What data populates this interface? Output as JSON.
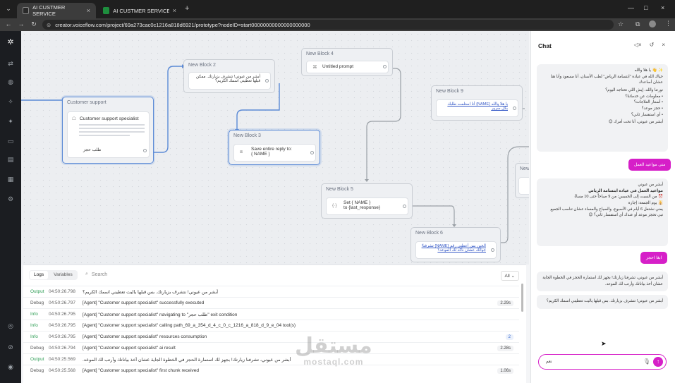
{
  "browser": {
    "tabs": [
      {
        "title": "AI CUSTMER SERVICE",
        "active": true
      },
      {
        "title": "AI CUSTMER SERVICE - Google",
        "active": false
      }
    ],
    "url": "creator.voiceflow.com/project/69a273cac0c1216a818d6921/prototype?nodeID=start00000000000000000000"
  },
  "canvas": {
    "customer_support": {
      "header": "Customer support",
      "title": "Customer support specialist",
      "exit_label": "طلب حجز"
    },
    "block2": {
      "header": "New Block 2",
      "text": "أبشر من عيوني! نتشرف بزيارتك. ممكن قبلها تعطيني اسمك الكريم؟"
    },
    "block3": {
      "header": "New Block 3",
      "text": "Save entire reply to:",
      "var": "{ NAME }"
    },
    "block4": {
      "header": "New Block 4",
      "text": "Untitled prompt"
    },
    "block5": {
      "header": "New Block 5",
      "line1": "Set { NAME }",
      "line2": "to {last_response}"
    },
    "block6": {
      "header": "New Block 6",
      "text": "الحين بس أعطني رقم {NAME} تشرفنا! جوالك عشان نأكد لك الموعد؟"
    },
    "block9": {
      "header": "New Block 9",
      "text": "يا هلا والله {NAME} أنا استلمت طلبك بكل سرور"
    },
    "block_partial": {
      "header": "New"
    }
  },
  "logs": {
    "tabs": [
      "Logs",
      "Variables"
    ],
    "search_placeholder": "Search",
    "filter": "All",
    "rows": [
      {
        "level": "Output",
        "time": "04:50:26.798",
        "message": "أبشر من عيوني! نتشرف بزيارتك. بس قبلها ياليت تعطيني اسمك الكريم؟",
        "badge": ""
      },
      {
        "level": "Debug",
        "time": "04:50:26.797",
        "message": "[Agent] \"Customer support specialist\" successfully executed",
        "badge": "2.29s"
      },
      {
        "level": "Info",
        "time": "04:50:26.795",
        "message": "[Agent] \"Customer support specialist\" navigating to \"طلب حجز\" exit condition",
        "badge": ""
      },
      {
        "level": "Info",
        "time": "04:50:26.795",
        "message": "[Agent] \"Customer support specialist\" calling path_69_a_354_d_4_c_0_c_1216_a_818_d_9_e_04 tool(s)",
        "badge": ""
      },
      {
        "level": "Info",
        "time": "04:50:26.795",
        "message": "[Agent] \"Customer support specialist\" resources consumption",
        "badge": "2"
      },
      {
        "level": "Debug",
        "time": "04:50:26.794",
        "message": "[Agent] \"Customer support specialist\" ai result",
        "badge": "2.28s"
      },
      {
        "level": "Output",
        "time": "04:50:25.569",
        "message": "أبشر من عيوني، تشرفنا زيارتك! بجهز لك استمارة الحجز في الخطوة الجاية عشان أخذ بياناتك وأرتب لك الموعد.",
        "badge": ""
      },
      {
        "level": "Debug",
        "time": "04:50:25.568",
        "message": "[Agent] \"Customer support specialist\" first chunk received",
        "badge": "1.06s"
      }
    ]
  },
  "chat": {
    "title": "Chat",
    "messages": [
      {
        "role": "bot",
        "lines": [
          "✨ 👋 يا هلا والله",
          "حياك الله في عيادة \"ابتسامة الرياض\" لطب الأسنان، أنا مسعود وأنا هنا عشان أساعدك",
          "نورتنا والله، إيش اللي تحتاجه اليوم؟",
          "• معلومات عن خدماتنا؟",
          "• أسعار العلاجات؟",
          "• حجز موعد؟",
          "• أي استفسار ثاني؟",
          "أبشر من عيوني، أنا تحت أمرك 😊"
        ]
      },
      {
        "role": "user",
        "text": "متى مواعيد العمل"
      },
      {
        "role": "bot",
        "lines": [
          "أبشر من عيوني",
          "مواعيد العمل في عيادة ابتسامة الرياض",
          "⏰ من السبت إلى الخميس: من 9 صباحاً حتى 10 مساءً",
          "🕌 يوم الجمعة: إجازة",
          "يعني نشتغل 6 أيام في الأسبوع، والصباح والمساء عشان تناسب الجميع",
          "تبي تحجز موعد أو عندك أي استفسار ثاني؟ 😊"
        ]
      },
      {
        "role": "user",
        "text": "ابغا احجز"
      },
      {
        "role": "bot",
        "lines": [
          "أبشر من عيوني، تشرفنا زيارتك! بجهز لك استمارة الحجز في الخطوة الجاية عشان أخذ بياناتك وأرتب لك الموعد."
        ]
      },
      {
        "role": "bot",
        "lines": [
          "أبشر من عيوني! نتشرف بزيارتك. بس قبلها ياليت تعطيني اسمك الكريم؟"
        ]
      }
    ],
    "input_value": "نعم"
  },
  "watermark": {
    "arabic": "مستقل",
    "latin": "mostaql.com"
  },
  "colors": {
    "accent": "#d61fc8",
    "selection": "#5b8ad6",
    "info": "#2f9e56"
  }
}
